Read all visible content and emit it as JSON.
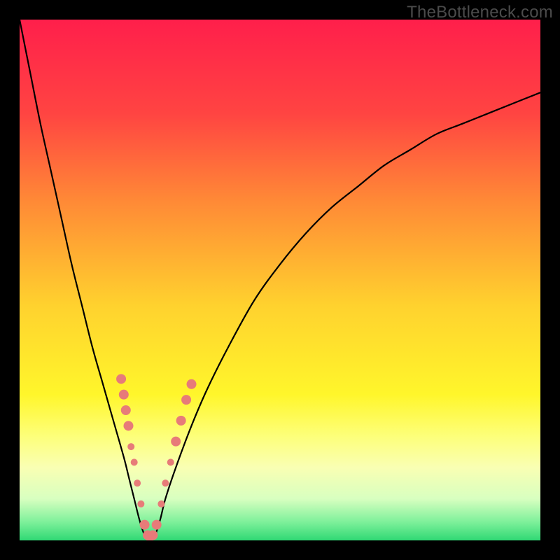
{
  "watermark": "TheBottleneck.com",
  "chart_data": {
    "type": "line",
    "title": "",
    "xlabel": "",
    "ylabel": "",
    "xlim": [
      0,
      100
    ],
    "ylim": [
      0,
      100
    ],
    "grid": false,
    "legend": false,
    "background": {
      "type": "vertical-gradient",
      "stops": [
        {
          "pos": 0.0,
          "color": "#ff1f4b"
        },
        {
          "pos": 0.18,
          "color": "#ff4442"
        },
        {
          "pos": 0.35,
          "color": "#ff8a36"
        },
        {
          "pos": 0.55,
          "color": "#ffd22e"
        },
        {
          "pos": 0.72,
          "color": "#fff62b"
        },
        {
          "pos": 0.8,
          "color": "#fdff7a"
        },
        {
          "pos": 0.86,
          "color": "#f9ffb3"
        },
        {
          "pos": 0.92,
          "color": "#d8ffc0"
        },
        {
          "pos": 0.965,
          "color": "#7df09a"
        },
        {
          "pos": 1.0,
          "color": "#2fd874"
        }
      ]
    },
    "series": [
      {
        "name": "bottleneck-curve",
        "color": "#000000",
        "x": [
          0,
          2,
          4,
          6,
          8,
          10,
          12,
          14,
          16,
          18,
          20,
          21,
          22,
          23,
          24,
          25,
          26,
          27,
          28,
          30,
          33,
          36,
          40,
          45,
          50,
          55,
          60,
          65,
          70,
          75,
          80,
          85,
          90,
          95,
          100
        ],
        "y": [
          100,
          90,
          80,
          71,
          62,
          53,
          45,
          37,
          30,
          23,
          16,
          12,
          8,
          4,
          1,
          0,
          1,
          4,
          8,
          14,
          22,
          29,
          37,
          46,
          53,
          59,
          64,
          68,
          72,
          75,
          78,
          80,
          82,
          84,
          86
        ]
      }
    ],
    "markers": {
      "name": "highlighted-points",
      "color": "#e77b79",
      "radius_small": 5,
      "radius_large": 7,
      "points": [
        {
          "x": 19.5,
          "y": 31,
          "r": "large"
        },
        {
          "x": 20.0,
          "y": 28,
          "r": "large"
        },
        {
          "x": 20.4,
          "y": 25,
          "r": "large"
        },
        {
          "x": 20.9,
          "y": 22,
          "r": "large"
        },
        {
          "x": 21.4,
          "y": 18,
          "r": "small"
        },
        {
          "x": 22.0,
          "y": 15,
          "r": "small"
        },
        {
          "x": 22.6,
          "y": 11,
          "r": "small"
        },
        {
          "x": 23.3,
          "y": 7,
          "r": "small"
        },
        {
          "x": 24.0,
          "y": 3,
          "r": "large"
        },
        {
          "x": 24.6,
          "y": 1,
          "r": "large"
        },
        {
          "x": 25.0,
          "y": 0,
          "r": "small"
        },
        {
          "x": 25.6,
          "y": 1,
          "r": "large"
        },
        {
          "x": 26.3,
          "y": 3,
          "r": "large"
        },
        {
          "x": 27.2,
          "y": 7,
          "r": "small"
        },
        {
          "x": 28.0,
          "y": 11,
          "r": "small"
        },
        {
          "x": 29.0,
          "y": 15,
          "r": "small"
        },
        {
          "x": 30.0,
          "y": 19,
          "r": "large"
        },
        {
          "x": 31.0,
          "y": 23,
          "r": "large"
        },
        {
          "x": 32.0,
          "y": 27,
          "r": "large"
        },
        {
          "x": 33.0,
          "y": 30,
          "r": "large"
        }
      ]
    }
  }
}
